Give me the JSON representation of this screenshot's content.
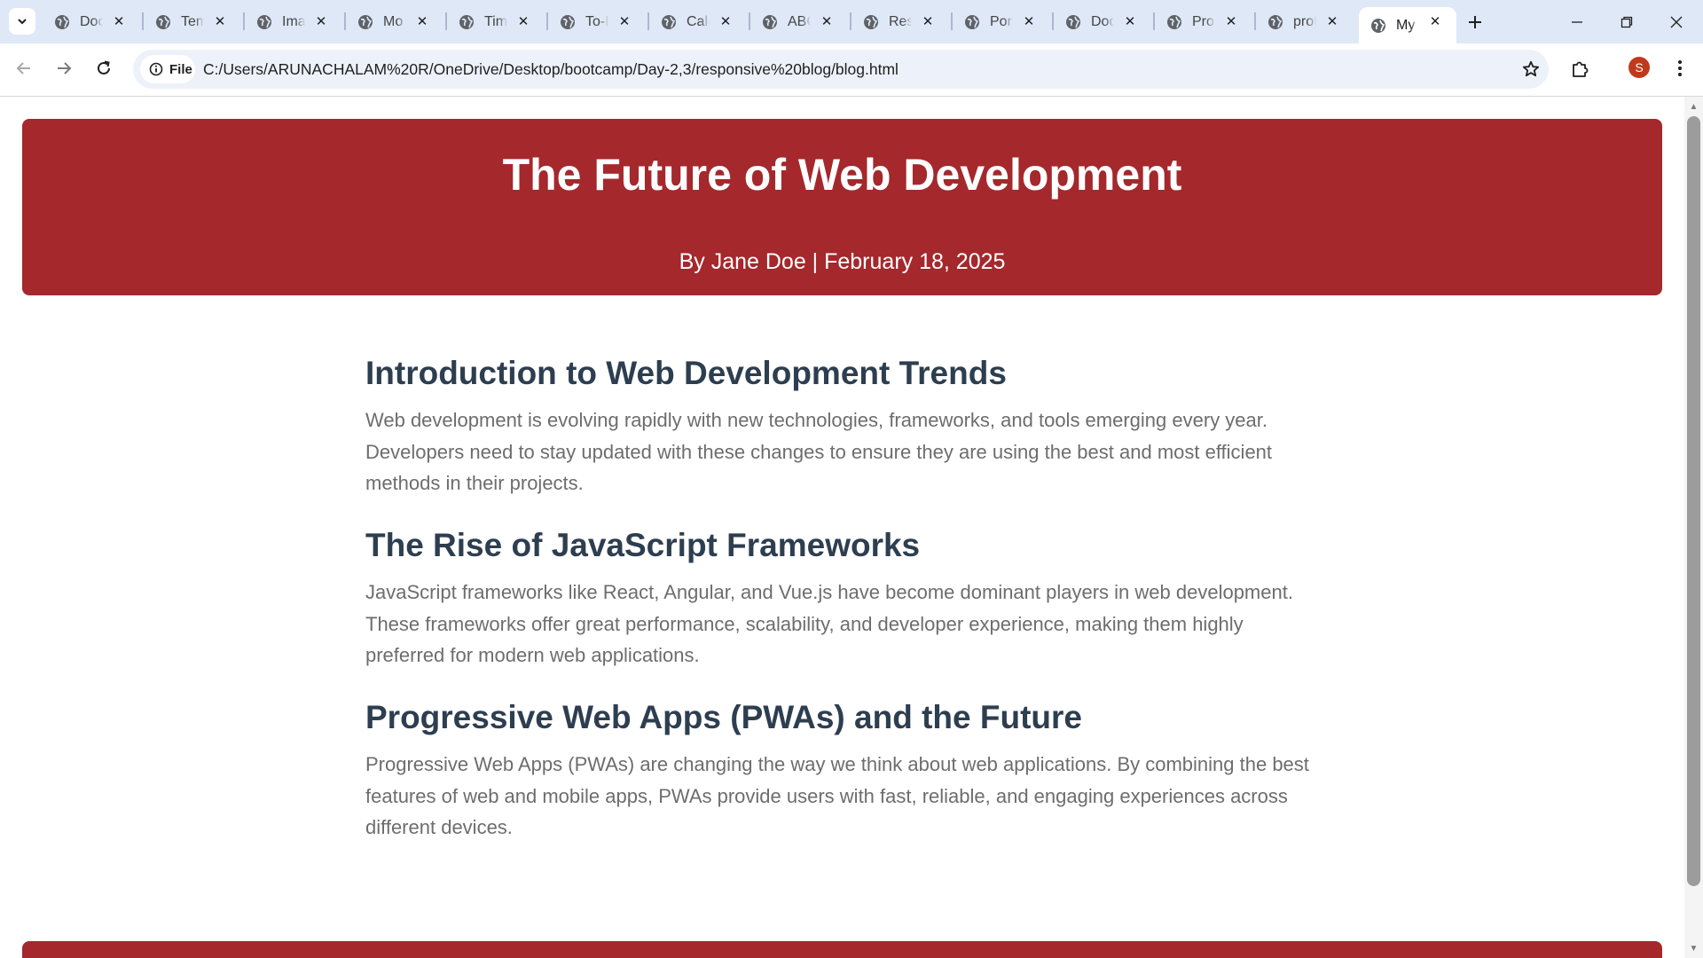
{
  "browser": {
    "tabs": [
      {
        "title": "Doc"
      },
      {
        "title": "Tem"
      },
      {
        "title": "Ima"
      },
      {
        "title": "Mo"
      },
      {
        "title": "Tim"
      },
      {
        "title": "To-D"
      },
      {
        "title": "Calc"
      },
      {
        "title": "ABC"
      },
      {
        "title": "Resi"
      },
      {
        "title": "Port"
      },
      {
        "title": "Doc"
      },
      {
        "title": "Pro"
      },
      {
        "title": "prof"
      },
      {
        "title": "My"
      }
    ],
    "active_tab_index": 13,
    "site_chip_label": "File",
    "url": "C:/Users/ARUNACHALAM%20R/OneDrive/Desktop/bootcamp/Day-2,3/responsive%20blog/blog.html",
    "profile_initial": "S",
    "profile_color": "#c0391b"
  },
  "page": {
    "accent": "#a4282c",
    "header": {
      "title": "The Future of Web Development",
      "meta": "By Jane Doe | February 18, 2025"
    },
    "sections": [
      {
        "heading": "Introduction to Web Development Trends",
        "body": "Web development is evolving rapidly with new technologies, frameworks, and tools emerging every year. Developers need to stay updated with these changes to ensure they are using the best and most efficient methods in their projects."
      },
      {
        "heading": "The Rise of JavaScript Frameworks",
        "body": "JavaScript frameworks like React, Angular, and Vue.js have become dominant players in web development. These frameworks offer great performance, scalability, and developer experience, making them highly preferred for modern web applications."
      },
      {
        "heading": "Progressive Web Apps (PWAs) and the Future",
        "body": "Progressive Web Apps (PWAs) are changing the way we think about web applications. By combining the best features of web and mobile apps, PWAs provide users with fast, reliable, and engaging experiences across different devices."
      }
    ]
  }
}
